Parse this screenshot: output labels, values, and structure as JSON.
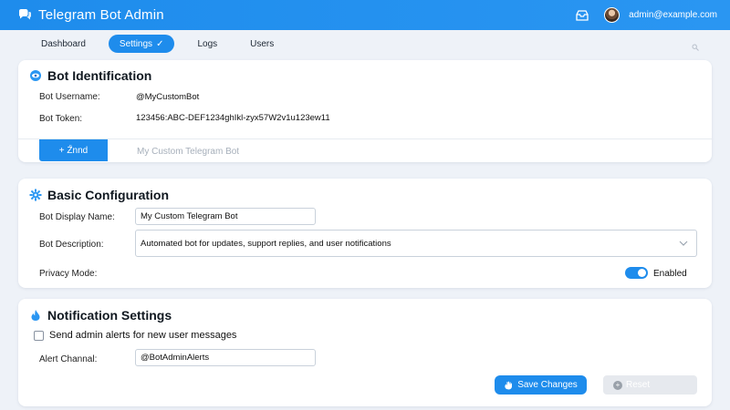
{
  "header": {
    "title": "Telegram Bot Admin",
    "user_email": "admin@example.com"
  },
  "nav": {
    "tabs": [
      {
        "label": "Dashboard"
      },
      {
        "label": "Settings"
      },
      {
        "label": "Logs"
      },
      {
        "label": "Users"
      }
    ],
    "active": "Settings"
  },
  "bot_identification": {
    "title": "Bot Identification",
    "username_label": "Bot Username:",
    "username_value": "@MyCustomBot",
    "token_label": "Bot Token:",
    "token_value": "123456:ABC-DEF1234ghIkl-zyx57W2v1u123ew11",
    "action_label": "+ Ź̈nnd",
    "preview_text": "My Custom Telegram Bot"
  },
  "basic_configuration": {
    "title": "Basic Configuration",
    "display_name_label": "Bot Display Name:",
    "display_name_value": "My Custom Telegram Bot",
    "description_label": "Bot Description:",
    "description_value": "Automated bot for updates, support replies, and user notifications",
    "privacy_label": "Privacy Mode:",
    "privacy_status": "Enabled"
  },
  "notification_settings": {
    "title": "Notification Settings",
    "alert_checkbox_label": "Send admin alerts for new user messages",
    "channel_label": "Alert Channal:",
    "channel_value": "@BotAdminAlerts",
    "save_label": "Save Changes",
    "reset_label": "Reset"
  },
  "colors": {
    "accent": "#1e8cec",
    "header_bg": "#2a96f2",
    "page_bg": "#eef2f8"
  },
  "icons": {
    "logo": "telegram-logo-icon",
    "inbox": "inbox-icon",
    "bot_identification": "eye-icon",
    "basic_configuration": "gear-icon",
    "notification": "drop-icon",
    "save": "hand-icon",
    "reset": "reset-icon"
  }
}
